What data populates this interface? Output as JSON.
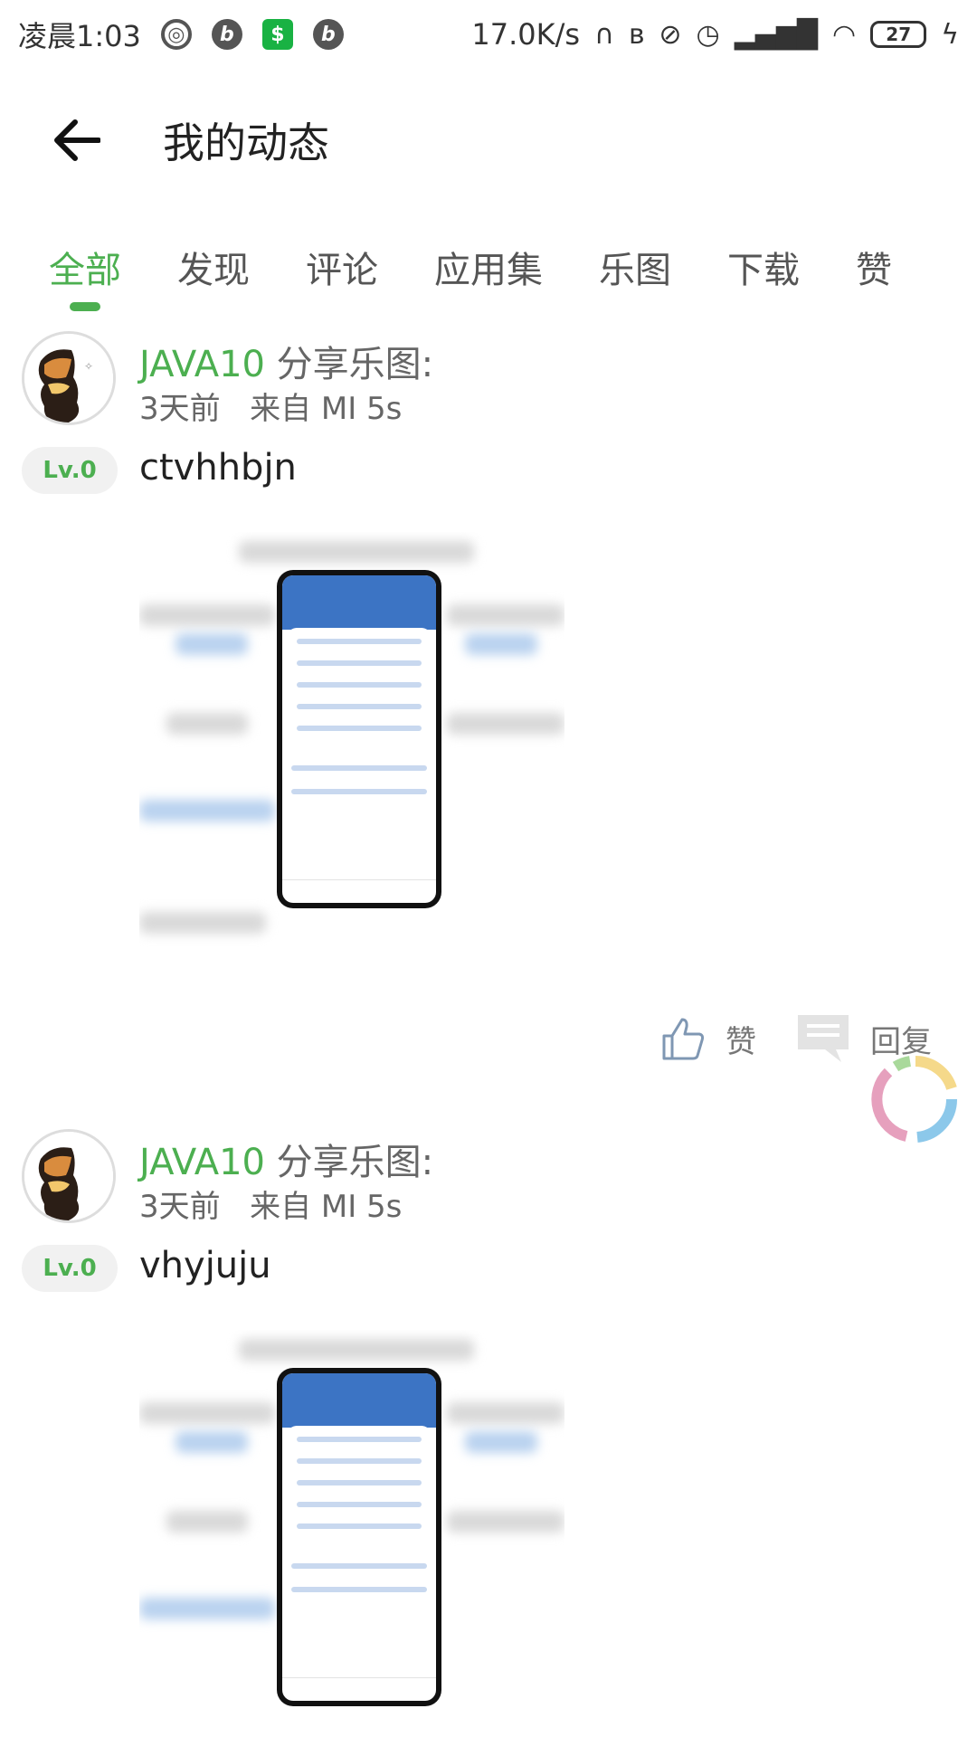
{
  "status_bar": {
    "time": "凌晨1:03",
    "net_speed": "17.0K/s",
    "battery": "27",
    "icons": [
      "netease-icon",
      "bilibili-icon",
      "shop-icon",
      "bilibili-icon",
      "headphone-icon",
      "bluetooth-icon",
      "mute-icon",
      "alarm-icon",
      "signal-icon",
      "wifi-icon",
      "battery-icon",
      "charging-icon"
    ]
  },
  "header": {
    "title": "我的动态"
  },
  "tabs": [
    {
      "label": "全部",
      "active": true
    },
    {
      "label": "发现",
      "active": false
    },
    {
      "label": "评论",
      "active": false
    },
    {
      "label": "应用集",
      "active": false
    },
    {
      "label": "乐图",
      "active": false
    },
    {
      "label": "下载",
      "active": false
    },
    {
      "label": "赞",
      "active": false
    }
  ],
  "posts": [
    {
      "author": "JAVA10",
      "action": " 分享乐图:",
      "time": "3天前",
      "source": "来自 MI 5s",
      "level": "Lv.0",
      "text": "ctvhhbjn",
      "actions": {
        "like": "赞",
        "reply": "回复"
      }
    },
    {
      "author": "JAVA10",
      "action": " 分享乐图:",
      "time": "3天前",
      "source": "来自 MI 5s",
      "level": "Lv.0",
      "text": "vhyjuju"
    }
  ],
  "colors": {
    "accent": "#4caf50",
    "phone_header": "#3c74c4"
  }
}
